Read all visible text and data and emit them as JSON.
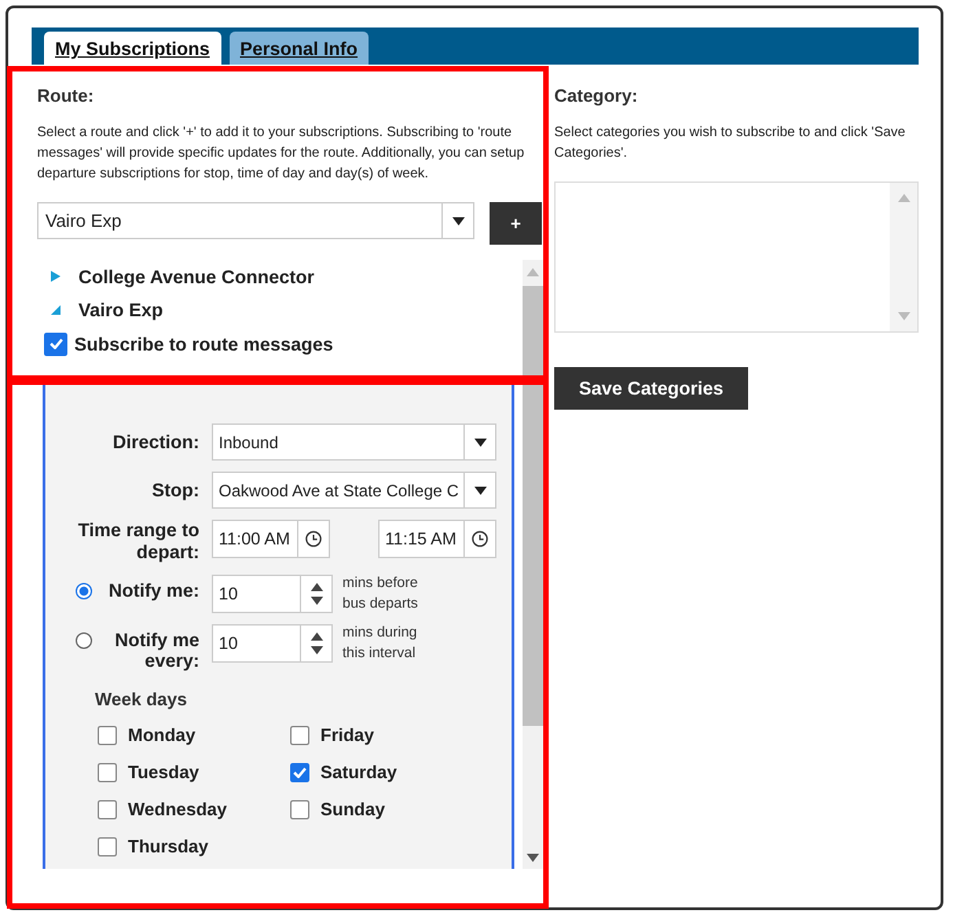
{
  "tabs": [
    {
      "label": "My Subscriptions",
      "selected": true
    },
    {
      "label": "Personal Info",
      "selected": false
    }
  ],
  "route": {
    "heading": "Route:",
    "description": "Select a route and click '+' to add it to your subscriptions. Subscribing to 'route messages' will provide specific updates for the route. Additionally, you can setup departure subscriptions for stop, time of day and day(s) of week.",
    "select_value": "Vairo Exp",
    "add_button": "+"
  },
  "route_list": [
    {
      "label": "College Avenue Connector",
      "expanded": false
    },
    {
      "label": "Vairo Exp",
      "expanded": true
    }
  ],
  "route_messages": {
    "label": "Subscribe to route messages",
    "checked": true
  },
  "departure": {
    "direction": {
      "label": "Direction:",
      "value": "Inbound"
    },
    "stop": {
      "label": "Stop:",
      "value": "Oakwood Ave at State College C"
    },
    "time_range": {
      "label": "Time range to depart:",
      "from": "11:00 AM",
      "to": "11:15 AM"
    },
    "notify": [
      {
        "label": "Notify me:",
        "selected": true,
        "value": "10",
        "unit": "mins before bus departs"
      },
      {
        "label": "Notify me every:",
        "selected": false,
        "value": "10",
        "unit": "mins during this interval"
      }
    ],
    "week_days_heading": "Week days",
    "week_days": [
      {
        "label": "Monday",
        "checked": false
      },
      {
        "label": "Tuesday",
        "checked": false
      },
      {
        "label": "Wednesday",
        "checked": false
      },
      {
        "label": "Thursday",
        "checked": false
      },
      {
        "label": "Friday",
        "checked": false
      },
      {
        "label": "Saturday",
        "checked": true
      },
      {
        "label": "Sunday",
        "checked": false
      }
    ]
  },
  "category": {
    "heading": "Category:",
    "description": "Select categories you wish to subscribe to and click 'Save Categories'.",
    "save_button": "Save Categories"
  },
  "annotations": [
    {
      "kind": "rectangle",
      "color": "#ff0000"
    },
    {
      "kind": "rectangle",
      "color": "#ff0000"
    }
  ]
}
